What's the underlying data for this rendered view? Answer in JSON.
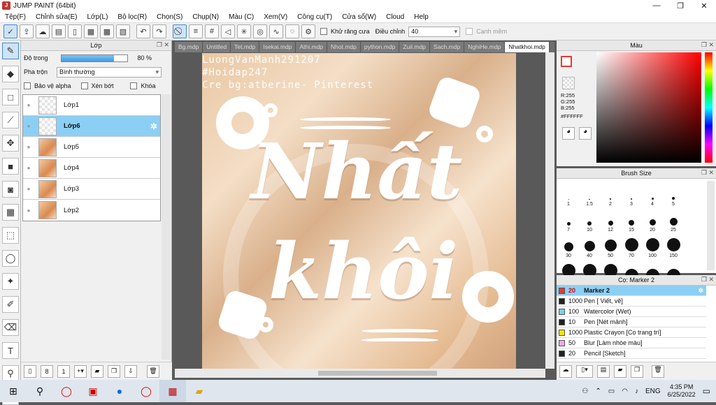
{
  "window": {
    "title": "JUMP PAINT (64bit)",
    "min": "—",
    "max": "❐",
    "close": "✕"
  },
  "menu": [
    "Tệp(F)",
    "Chỉnh sửa(E)",
    "Lớp(L)",
    "Bộ lọc(R)",
    "Chọn(S)",
    "Chụp(N)",
    "Màu (C)",
    "Xem(V)",
    "Công cụ(T)",
    "Cửa sổ(W)",
    "Cloud",
    "Help"
  ],
  "toolbar": {
    "antialias_label": "Khử răng cưa",
    "adjust_label": "Điều chỉnh",
    "adjust_value": "40",
    "smooth_label": "Cạnh mềm"
  },
  "layers_panel": {
    "title": "Lớp",
    "opacity_label": "Độ trong",
    "opacity_value": "80 %",
    "opacity_fraction": 0.8,
    "blend_label": "Pha trộn",
    "blend_value": "Bình thường",
    "protect_alpha": "Bảo vệ alpha",
    "clip": "Xén bớt",
    "lock": "Khóa",
    "layers": [
      {
        "name": "Lớp1",
        "thumb": "checker",
        "active": false
      },
      {
        "name": "Lớp6",
        "thumb": "checker",
        "active": true
      },
      {
        "name": "Lớp5",
        "thumb": "image",
        "active": false
      },
      {
        "name": "Lớp4",
        "thumb": "image",
        "active": false
      },
      {
        "name": "Lớp3",
        "thumb": "image",
        "active": false
      },
      {
        "name": "Lớp2",
        "thumb": "image",
        "active": false
      }
    ]
  },
  "tabs": [
    {
      "label": "Bg.mdp",
      "active": false
    },
    {
      "label": "Untitled",
      "active": false
    },
    {
      "label": "Tet.mdp",
      "active": false
    },
    {
      "label": "Isekai.mdp",
      "active": false
    },
    {
      "label": "Athi.mdp",
      "active": false
    },
    {
      "label": "Nhot.mdp",
      "active": false
    },
    {
      "label": "python.mdp",
      "active": false
    },
    {
      "label": "Zuii.mdp",
      "active": false
    },
    {
      "label": "Sach.mdp",
      "active": false
    },
    {
      "label": "NghiHe.mdp",
      "active": false
    },
    {
      "label": "Nhatkhoi.mdp",
      "active": true
    }
  ],
  "artwork": {
    "watermark": [
      "LuongVanManh291207",
      "#Hoidap247",
      "Cre bg:atberine- Pinterest"
    ],
    "line1": "Nhất",
    "line2": "khôi"
  },
  "color_panel": {
    "title": "Màu",
    "r": "R:255",
    "g": "G:255",
    "b": "B:255",
    "hex": "#FFFFFF",
    "fg": "#e53935",
    "bg": "#ffffff"
  },
  "brush_panel": {
    "title": "Brush Size",
    "sizes": [
      "1",
      "1.5",
      "2",
      "3",
      "4",
      "5",
      "7",
      "10",
      "12",
      "15",
      "20",
      "25",
      "30",
      "40",
      "50",
      "70",
      "100",
      "150",
      "200",
      "300",
      "400",
      "",
      "",
      ""
    ]
  },
  "marker_panel": {
    "title": "Cọ: Marker 2",
    "items": [
      {
        "size": "20",
        "name": "Marker 2",
        "color": "#e53935",
        "active": true
      },
      {
        "size": "1000",
        "name": "Pen [ Viết, vẽ]",
        "color": "#222222",
        "active": false
      },
      {
        "size": "100",
        "name": "Watercolor (Wet)",
        "color": "#6fd3f5",
        "active": false
      },
      {
        "size": "10",
        "name": "Pen [Nét mảnh]",
        "color": "#222222",
        "active": false
      },
      {
        "size": "1000",
        "name": "Plastic Crayon [Cọ trang trí]",
        "color": "#f3e600",
        "active": false
      },
      {
        "size": "50",
        "name": "Blur [Làm nhòe màu]",
        "color": "#f4a7e6",
        "active": false
      },
      {
        "size": "20",
        "name": "Pencil [Sketch]",
        "color": "#222222",
        "active": false
      }
    ]
  },
  "taskbar": {
    "lang": "ENG",
    "time": "4:35 PM",
    "date": "6/25/2022"
  }
}
